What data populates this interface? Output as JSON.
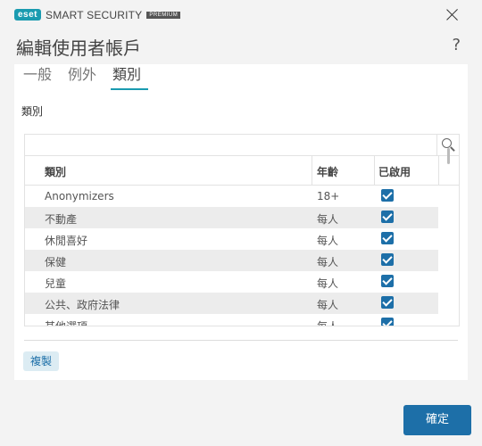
{
  "app": {
    "brand": "eset",
    "product": "SMART SECURITY",
    "edition": "PREMIUM"
  },
  "dialog": {
    "title": "編輯使用者帳戶",
    "help": "?"
  },
  "tabs": [
    {
      "label": "一般",
      "active": false
    },
    {
      "label": "例外",
      "active": false
    },
    {
      "label": "類別",
      "active": true
    }
  ],
  "section_label": "類別",
  "table": {
    "search_value": "",
    "columns": [
      "類別",
      "年齡",
      "已啟用"
    ],
    "rows": [
      {
        "category": "Anonymizers",
        "age": "18+",
        "enabled": true
      },
      {
        "category": "不動產",
        "age": "每人",
        "enabled": true
      },
      {
        "category": "休閒喜好",
        "age": "每人",
        "enabled": true
      },
      {
        "category": "保健",
        "age": "每人",
        "enabled": true
      },
      {
        "category": "兒童",
        "age": "每人",
        "enabled": true
      },
      {
        "category": "公共、政府法律",
        "age": "每人",
        "enabled": true
      },
      {
        "category": "其他選項",
        "age": "每人",
        "enabled": true
      }
    ]
  },
  "buttons": {
    "copy": "複製",
    "ok": "確定"
  },
  "colors": {
    "accent": "#1a9bb0",
    "primary": "#1d6fa8",
    "checkbox": "#1d6fa8"
  }
}
